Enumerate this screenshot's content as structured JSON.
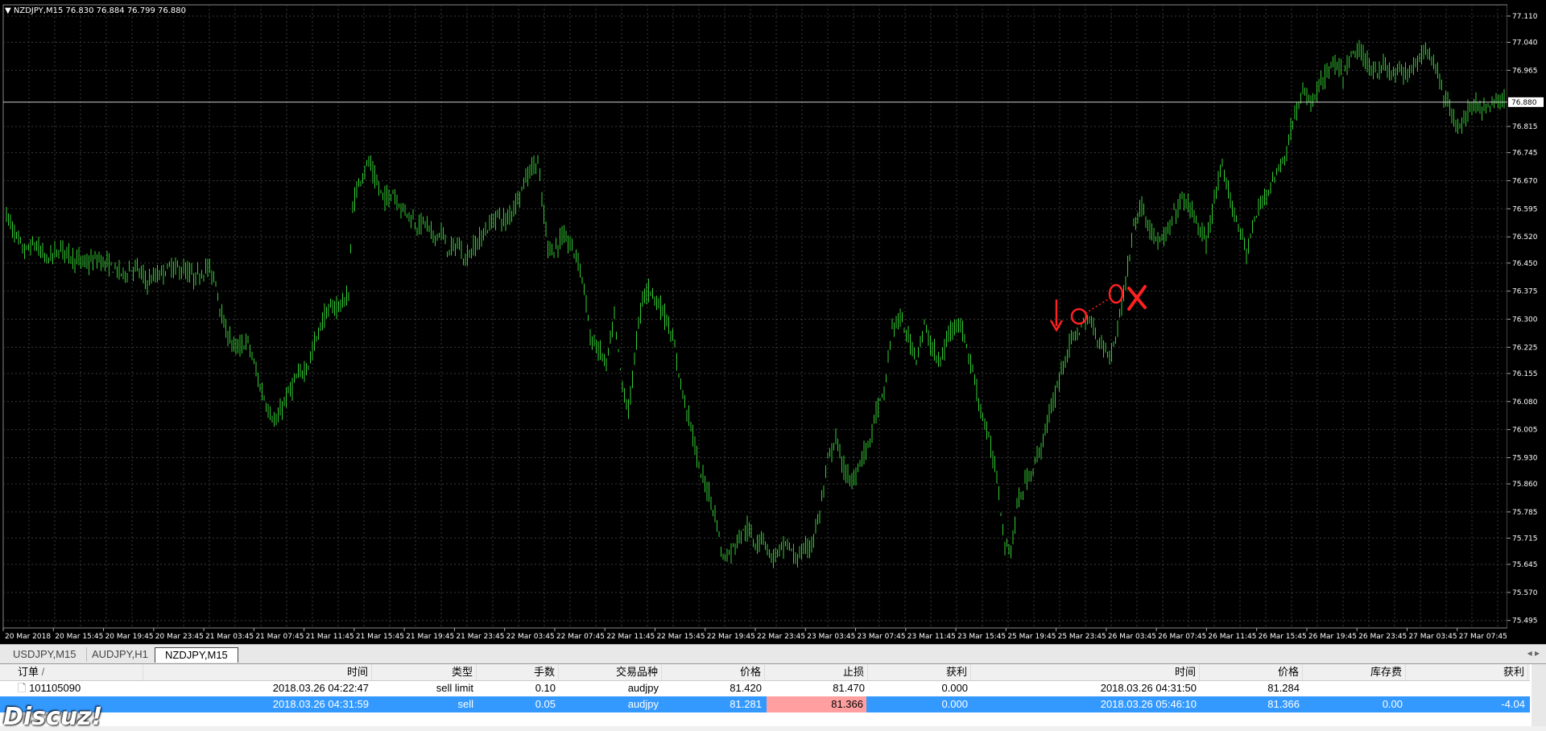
{
  "chart": {
    "info": "NZDJPY,M15  76.830 76.884 76.799 76.880",
    "current_price": "76.880",
    "colors": {
      "background": "#000000",
      "candle": "#33cc33",
      "grid": "#3a3a3a",
      "axis_text": "#ffffff",
      "annotation": "#ff2020",
      "price_line": "#d0d0d0"
    },
    "price_labels": [
      "77.110",
      "77.040",
      "76.965",
      "76.815",
      "76.745",
      "76.670",
      "76.595",
      "76.520",
      "76.450",
      "76.375",
      "76.300",
      "76.225",
      "76.155",
      "76.080",
      "76.005",
      "75.930",
      "75.860",
      "75.785",
      "75.715",
      "75.645",
      "75.570",
      "75.495"
    ],
    "time_labels": [
      "20 Mar 2018",
      "20 Mar 15:45",
      "20 Mar 19:45",
      "20 Mar 23:45",
      "21 Mar 03:45",
      "21 Mar 07:45",
      "21 Mar 11:45",
      "21 Mar 15:45",
      "21 Mar 19:45",
      "21 Mar 23:45",
      "22 Mar 03:45",
      "22 Mar 07:45",
      "22 Mar 11:45",
      "22 Mar 15:45",
      "22 Mar 19:45",
      "22 Mar 23:45",
      "23 Mar 03:45",
      "23 Mar 07:45",
      "23 Mar 11:45",
      "23 Mar 15:45",
      "25 Mar 19:45",
      "25 Mar 23:45",
      "26 Mar 03:45",
      "26 Mar 07:45",
      "26 Mar 11:45",
      "26 Mar 15:45",
      "26 Mar 19:45",
      "26 Mar 23:45",
      "27 Mar 03:45",
      "27 Mar 07:45"
    ]
  },
  "tabs": [
    {
      "label": "USDJPY,M15",
      "active": false
    },
    {
      "label": "AUDJPY,H1",
      "active": false
    },
    {
      "label": "NZDJPY,M15",
      "active": true
    }
  ],
  "orders": {
    "headers": {
      "order": "订单",
      "sort": "/",
      "time": "时间",
      "type": "类型",
      "lots": "手数",
      "symbol": "交易品种",
      "price": "价格",
      "sl": "止损",
      "tp": "获利",
      "close_time": "时间",
      "close_price": "价格",
      "swap": "库存费",
      "profit": "获利"
    },
    "rows": [
      {
        "order": "101105090",
        "time": "2018.03.26 04:22:47",
        "type": "sell limit",
        "lots": "0.10",
        "symbol": "audjpy",
        "price": "81.420",
        "sl": "81.470",
        "tp": "0.000",
        "close_time": "2018.03.26 04:31:50",
        "close_price": "81.284",
        "swap": "",
        "profit": ""
      },
      {
        "order": "",
        "time": "2018.03.26 04:31:59",
        "type": "sell",
        "lots": "0.05",
        "symbol": "audjpy",
        "price": "81.281",
        "sl": "81.366",
        "tp": "0.000",
        "close_time": "2018.03.26 05:46:10",
        "close_price": "81.366",
        "swap": "0.00",
        "profit": "-4.04"
      }
    ]
  },
  "watermark": "Discuz!"
}
